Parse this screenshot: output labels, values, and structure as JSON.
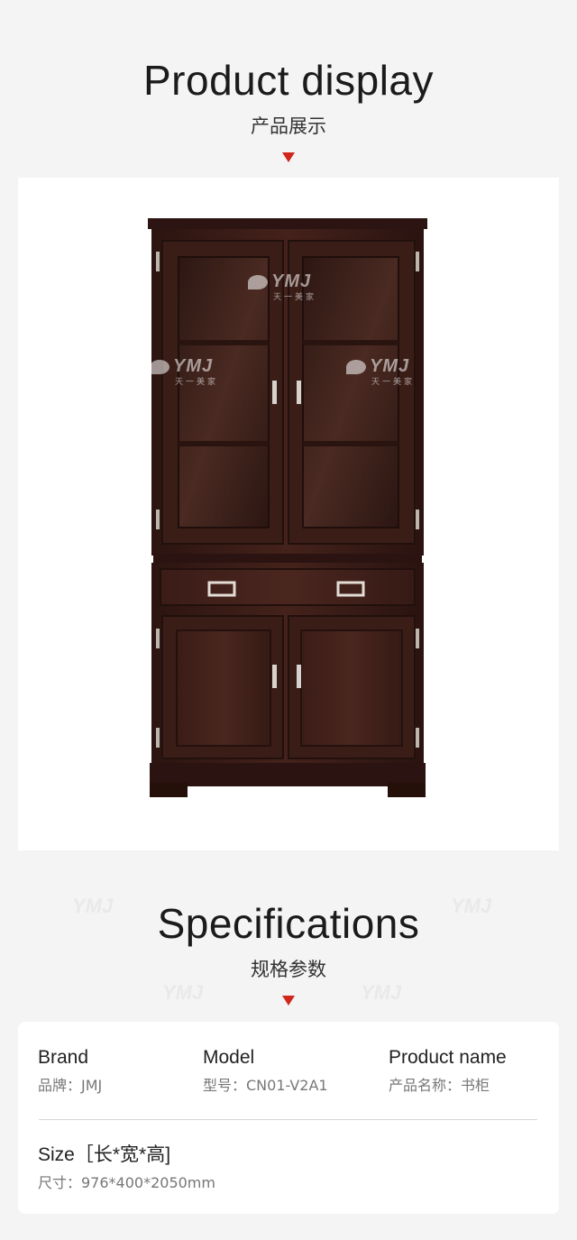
{
  "display_section": {
    "title_en": "Product display",
    "title_cn": "产品展示"
  },
  "watermark": {
    "brand": "YMJ",
    "brand_cn": "天一美家"
  },
  "spec_section": {
    "title_en": "Specifications",
    "title_cn": "规格参数"
  },
  "specs": {
    "brand": {
      "label": "Brand",
      "value": "品牌：JMJ"
    },
    "model": {
      "label": "Model",
      "value": "型号：CN01-V2A1"
    },
    "product_name": {
      "label": "Product name",
      "value": "产品名称：书柜"
    },
    "size": {
      "label": "Size［长*宽*高]",
      "value": "尺寸：976*400*2050mm"
    }
  },
  "colors": {
    "accent_triangle": "#d1261b",
    "wood_dark": "#3a1c17",
    "background": "#f4f4f4"
  }
}
